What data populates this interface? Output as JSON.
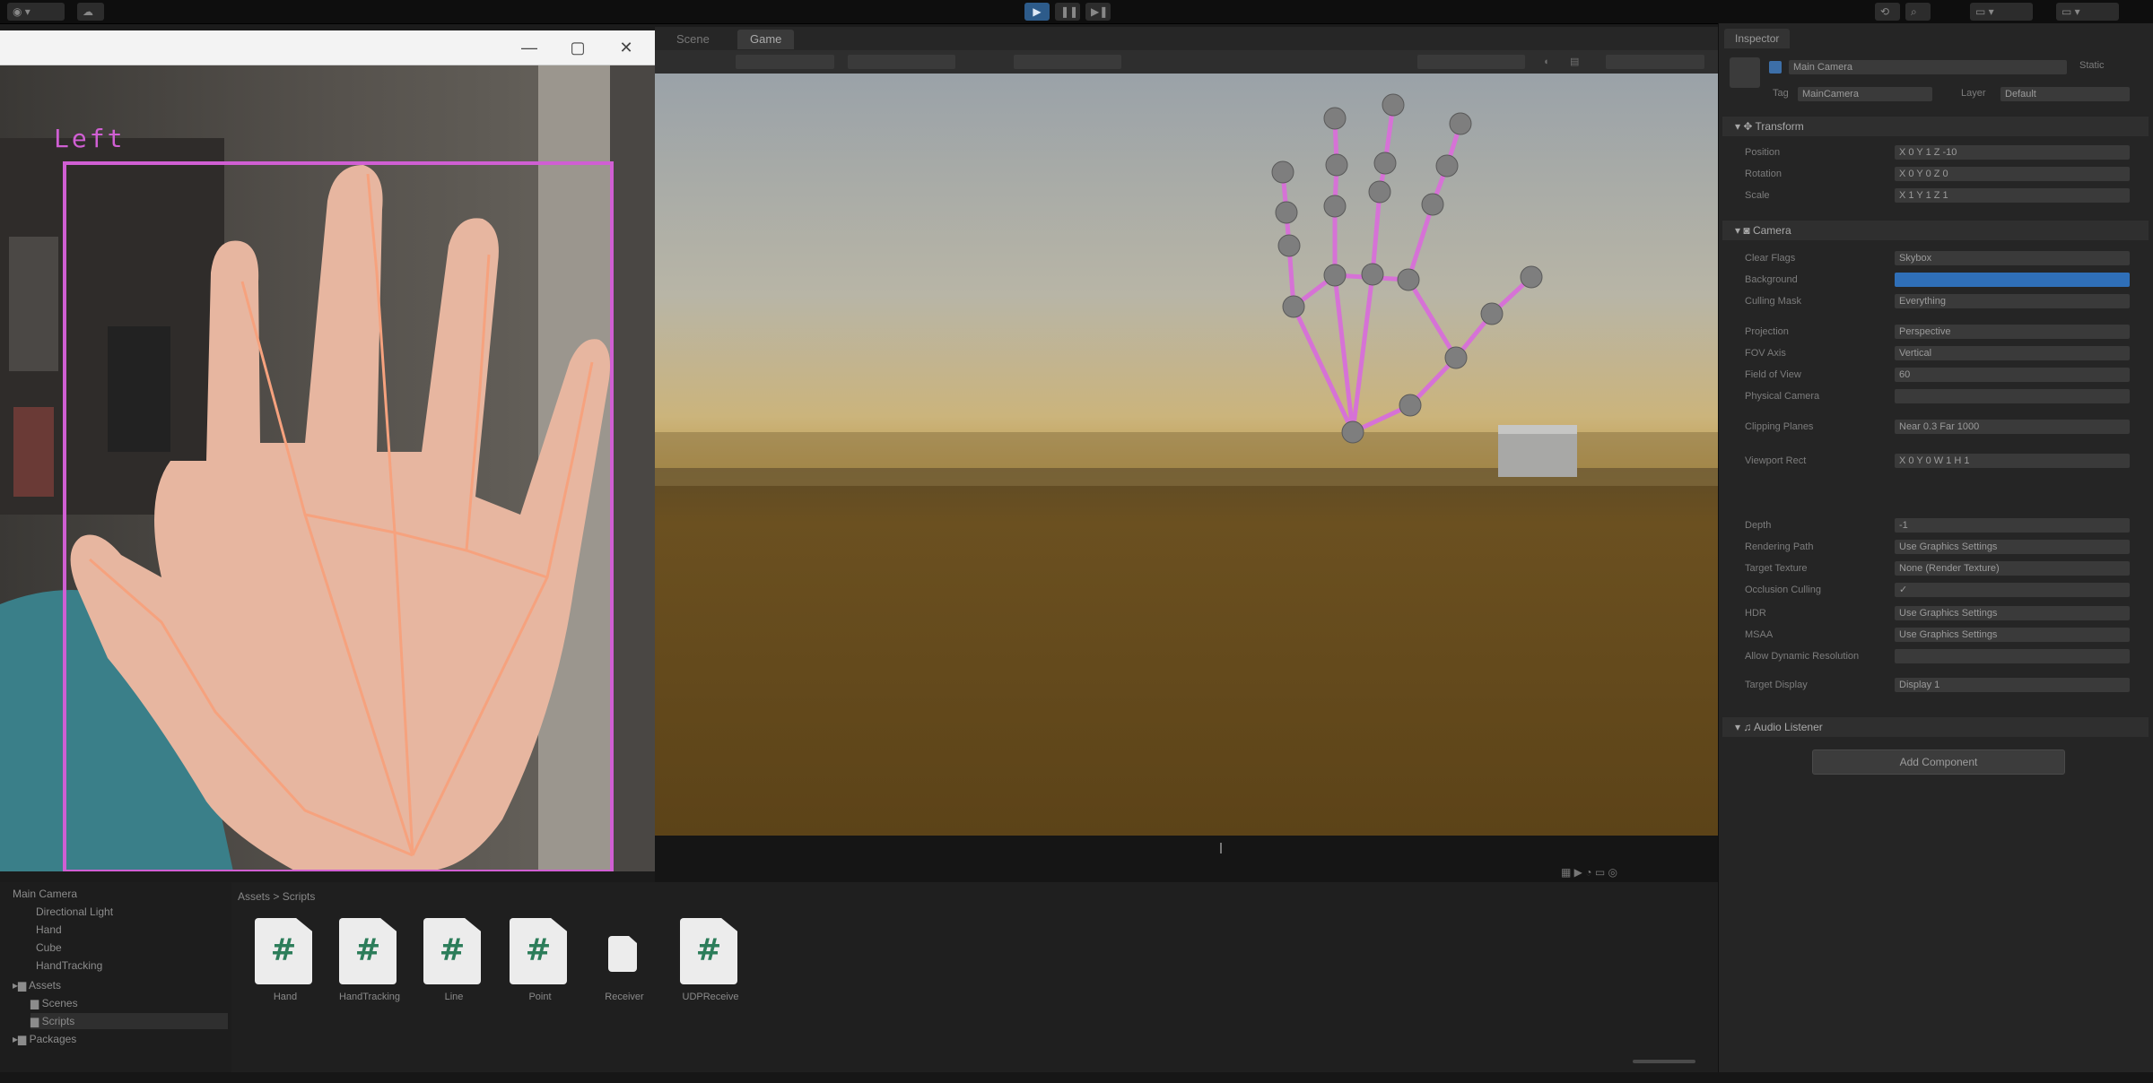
{
  "colors": {
    "landmark_line": "#f6a27e",
    "bbox": "#d05fd3",
    "scene_bone": "#d672d6",
    "joint": "#7e7e7e",
    "play_blue": "#2d5b8a"
  },
  "camera_window": {
    "hand_label": "Left",
    "minimize": "—",
    "maximize": "▢",
    "close": "✕"
  },
  "scene": {
    "tabs": [
      "Scene",
      "Game"
    ],
    "active_tab": "Game"
  },
  "hierarchy": {
    "items": [
      "Main Camera",
      "Directional Light",
      "Hand",
      "Cube",
      "HandTracking",
      "Assets",
      "Scenes",
      "Scripts",
      "Packages"
    ]
  },
  "project": {
    "breadcrumb": "Assets > Scripts",
    "files": [
      "Hand",
      "HandTracking",
      "Line",
      "Point",
      "Receiver",
      "UDPReceive"
    ]
  },
  "inspector": {
    "tab": "Inspector",
    "object_name": "Main Camera",
    "static_label": "Static",
    "tag_label": "Tag",
    "tag_value": "MainCamera",
    "layer_label": "Layer",
    "layer_value": "Default",
    "transform_header": "Transform",
    "transform_rows": [
      {
        "label": "Position",
        "value": "X 0   Y 1   Z -10"
      },
      {
        "label": "Rotation",
        "value": "X 0   Y 0   Z 0"
      },
      {
        "label": "Scale",
        "value": "X 1   Y 1   Z 1"
      }
    ],
    "camera_header": "Camera",
    "camera_rows": [
      {
        "label": "Clear Flags",
        "value": "Skybox"
      },
      {
        "label": "Background",
        "value": ""
      },
      {
        "label": "Culling Mask",
        "value": "Everything"
      },
      {
        "label": "Projection",
        "value": "Perspective"
      },
      {
        "label": "FOV Axis",
        "value": "Vertical"
      },
      {
        "label": "Field of View",
        "value": "60"
      },
      {
        "label": "Physical Camera",
        "value": ""
      },
      {
        "label": "Clipping Planes",
        "value": "Near 0.3   Far 1000"
      },
      {
        "label": "Viewport Rect",
        "value": "X 0  Y 0  W 1  H 1"
      },
      {
        "label": "Depth",
        "value": "-1"
      },
      {
        "label": "Rendering Path",
        "value": "Use Graphics Settings"
      },
      {
        "label": "Target Texture",
        "value": "None (Render Texture)"
      },
      {
        "label": "Occlusion Culling",
        "value": "✓"
      },
      {
        "label": "HDR",
        "value": "Use Graphics Settings"
      },
      {
        "label": "MSAA",
        "value": "Use Graphics Settings"
      },
      {
        "label": "Allow Dynamic Resolution",
        "value": ""
      },
      {
        "label": "Target Display",
        "value": "Display 1"
      }
    ],
    "audio_header": "Audio Listener",
    "add_component": "Add Component"
  }
}
